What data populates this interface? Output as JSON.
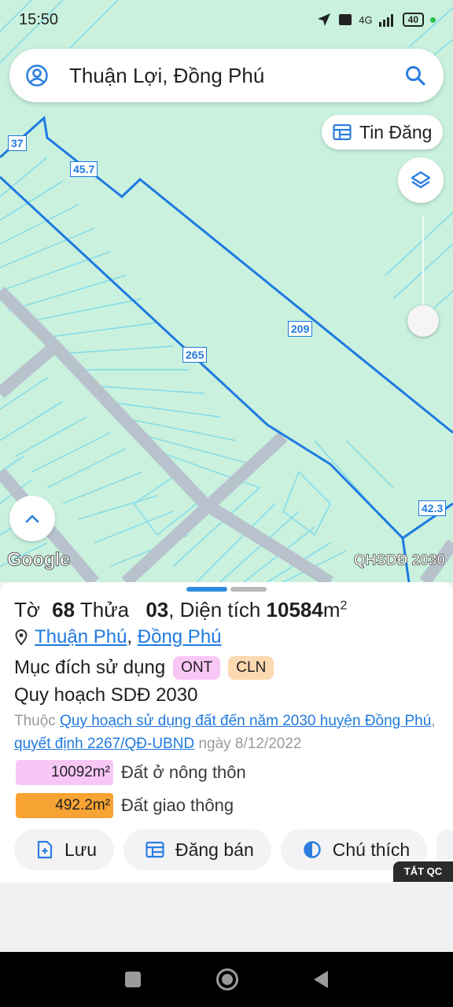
{
  "status_bar": {
    "time": "15:50",
    "network": "4G",
    "battery": "40"
  },
  "search": {
    "title": "Thuận Lợi, Đồng Phú"
  },
  "map": {
    "tin_dang_label": "Tin Đăng",
    "parcel_labels": [
      "37",
      "45.7",
      "209",
      "265",
      "42.3"
    ],
    "google_label": "Google",
    "layer_label": "QHSDĐ 2030"
  },
  "parcel": {
    "to_label": "Tờ",
    "to_number": "68",
    "thua_label": "Thửa",
    "thua_number": "03",
    "area_label": ", Diện tích",
    "area_value": "10584",
    "area_unit": "m",
    "area_sup": "2",
    "location_ward": "Thuận Phú",
    "location_separator": ",",
    "location_district": "Đồng Phú",
    "purpose_label": "Mục đích sử dụng",
    "purpose_badges": [
      {
        "code": "ONT",
        "color": "#f9c7f6"
      },
      {
        "code": "CLN",
        "color": "#fcd9b0"
      }
    ],
    "plan_title": "Quy hoạch SDĐ 2030",
    "plan_prefix": "Thuộc",
    "plan_link": "Quy hoạch sử dụng đất đến năm 2030 huyện Đồng Phú",
    "plan_separator": ",",
    "decision_link": "quyết định 2267/QĐ-UBND",
    "date_text": "ngày 8/12/2022",
    "areas": [
      {
        "value": "10092m²",
        "label": "Đất ở nông thôn",
        "color": "#f9c7f6"
      },
      {
        "value": "492.2m²",
        "label": "Đất giao thông",
        "color": "#f7a334"
      }
    ]
  },
  "actions": {
    "save_label": "Lưu",
    "post_label": "Đăng bán",
    "legend_label": "Chú thích"
  },
  "ad": {
    "close_label": "TẮT QC"
  },
  "colors": {
    "map_bg": "#c9f1de",
    "boundary": "#1f7ae0",
    "road": "#b8c2cc",
    "link": "#1f7ae0"
  }
}
